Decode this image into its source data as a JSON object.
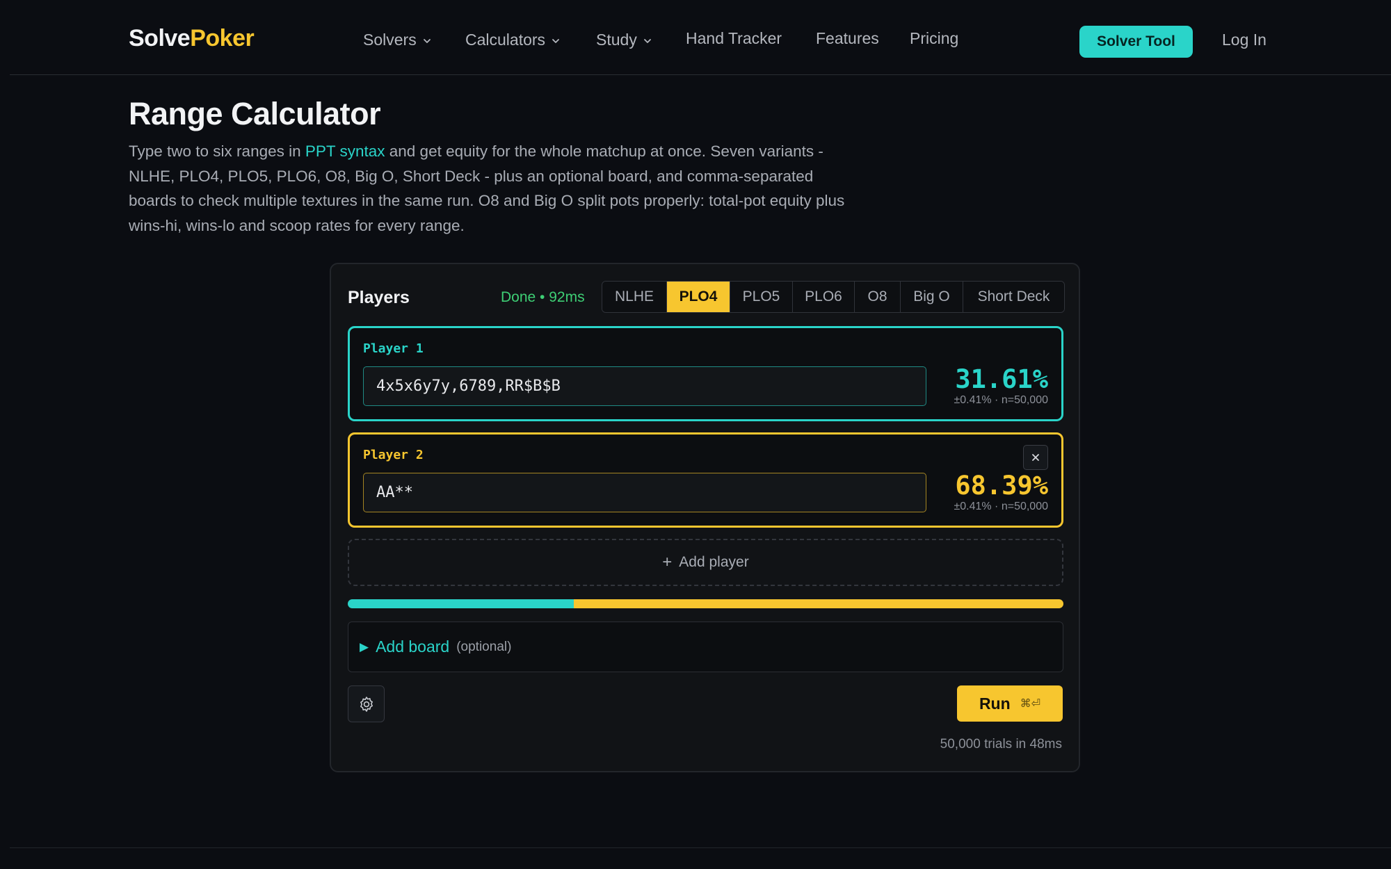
{
  "brand": {
    "part1": "Solve",
    "part2": "Poker"
  },
  "nav": {
    "items": [
      {
        "label": "Solvers",
        "dropdown": true
      },
      {
        "label": "Calculators",
        "dropdown": true
      },
      {
        "label": "Study",
        "dropdown": true
      },
      {
        "label": "Hand Tracker",
        "dropdown": false
      },
      {
        "label": "Features",
        "dropdown": false
      },
      {
        "label": "Pricing",
        "dropdown": false
      }
    ],
    "cta_label": "Solver Tool",
    "login_label": "Log In"
  },
  "page": {
    "title": "Range Calculator",
    "intro_before_link": "Type two to six ranges in ",
    "intro_link": "PPT syntax",
    "intro_after_link": " and get equity for the whole matchup at once. Seven variants - NLHE, PLO4, PLO5, PLO6, O8, Big O, Short Deck - plus an optional board, and comma-separated boards to check multiple textures in the same run. O8 and Big O split pots properly: total-pot equity plus wins-hi, wins-lo and scoop rates for every range."
  },
  "calculator": {
    "players_label": "Players",
    "status": "Done • 92ms",
    "variants": [
      "NLHE",
      "PLO4",
      "PLO5",
      "PLO6",
      "O8",
      "Big O",
      "Short Deck"
    ],
    "active_variant": "PLO4",
    "players": [
      {
        "name": "Player 1",
        "range": "4x5x6y7y,6789,RR$B$B",
        "equity": "31.61%",
        "meta": "±0.41% · n=50,000",
        "equity_fraction": 0.3161,
        "color": "#2ad4c9",
        "removable": false
      },
      {
        "name": "Player 2",
        "range": "AA**",
        "equity": "68.39%",
        "meta": "±0.41% · n=50,000",
        "equity_fraction": 0.6839,
        "color": "#f7c62f",
        "removable": true
      }
    ],
    "add_player_label": "Add player",
    "board_label": "Add board",
    "board_optional": "(optional)",
    "run_label": "Run",
    "run_shortcut": "⌘⏎",
    "trials_text": "50,000 trials in 48ms"
  },
  "colors": {
    "accent_teal": "#2ad4c9",
    "accent_yellow": "#f7c62f",
    "status_green": "#3ecf75",
    "background": "#0b0d12"
  },
  "icons": {
    "dropdown": "chevron-down-icon",
    "remove": "close-icon",
    "add": "plus-icon",
    "board_toggle": "triangle-right-icon",
    "settings": "gear-icon"
  }
}
